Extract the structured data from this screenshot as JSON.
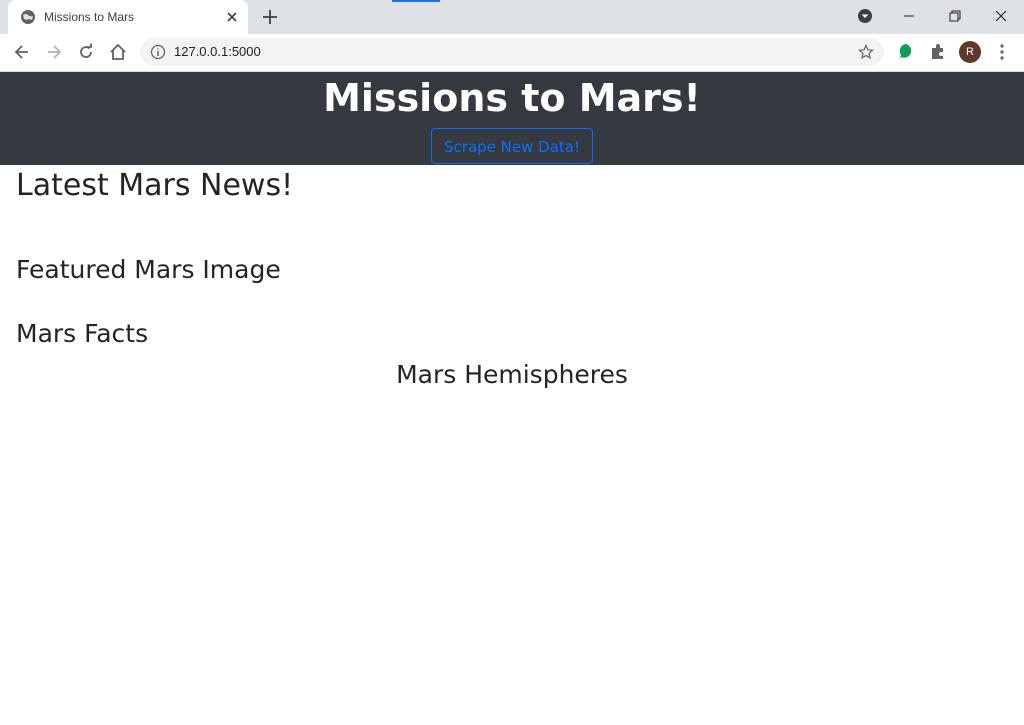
{
  "browser": {
    "tab_title": "Missions to Mars",
    "url": "127.0.0.1:5000",
    "profile_initial": "R"
  },
  "page": {
    "title": "Missions to Mars!",
    "scrape_button": "Scrape New Data!",
    "sections": {
      "news": "Latest Mars News!",
      "featured_image": "Featured Mars Image",
      "facts": "Mars Facts",
      "hemispheres": "Mars Hemispheres"
    }
  },
  "colors": {
    "header_bg": "#343a40",
    "button_accent": "#0d6efd",
    "tabstrip_bg": "#dee1e6"
  }
}
